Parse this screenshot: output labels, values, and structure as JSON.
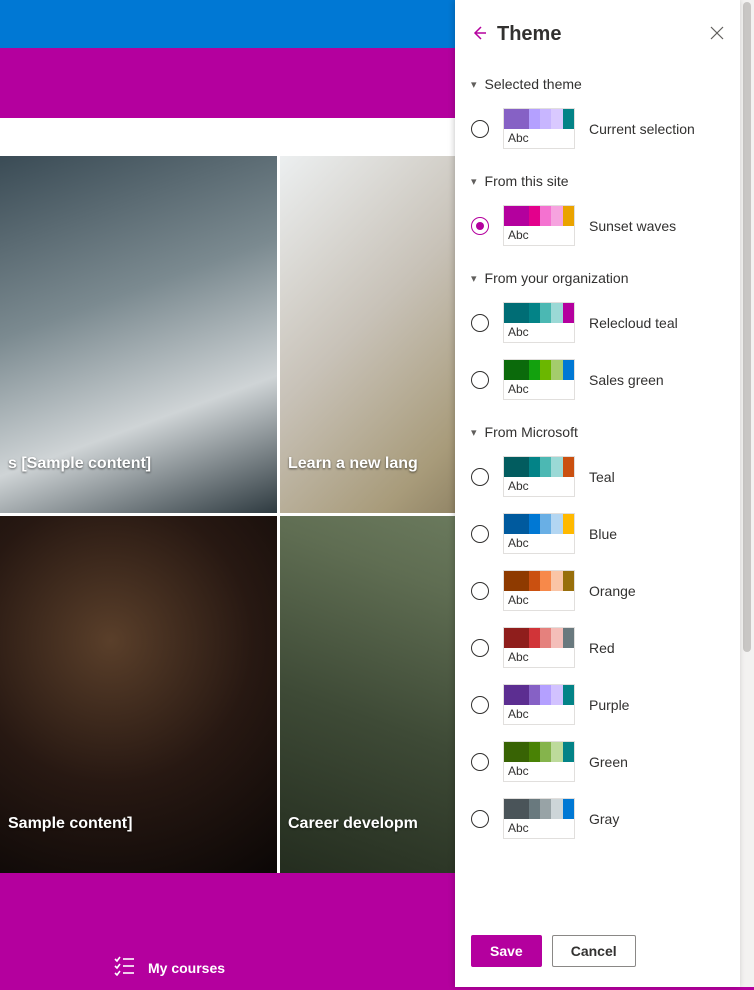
{
  "background": {
    "tiles": [
      {
        "caption": "s [Sample content]"
      },
      {
        "caption": "Learn a new lang"
      },
      {
        "caption": "Sample content]"
      },
      {
        "caption": "Career developm"
      }
    ],
    "bottombar_label": "My courses"
  },
  "panel": {
    "title": "Theme",
    "swatch_text": "Abc",
    "save_label": "Save",
    "cancel_label": "Cancel",
    "sections": [
      {
        "title": "Selected theme",
        "options": [
          {
            "name": "Current selection",
            "selected": false,
            "colors": [
              "#8661c5",
              "#b4a0ff",
              "#c8b6ff",
              "#d9c9ff",
              "#038387"
            ]
          }
        ]
      },
      {
        "title": "From this site",
        "options": [
          {
            "name": "Sunset waves",
            "selected": true,
            "colors": [
              "#b4009e",
              "#e3008c",
              "#f472d0",
              "#f6a3df",
              "#eaa300"
            ]
          }
        ]
      },
      {
        "title": "From your organization",
        "options": [
          {
            "name": "Relecloud teal",
            "selected": false,
            "colors": [
              "#006d75",
              "#038387",
              "#4bb8b3",
              "#9bd9d6",
              "#b4009e"
            ]
          },
          {
            "name": "Sales green",
            "selected": false,
            "colors": [
              "#0b6a0b",
              "#13a10e",
              "#6bb700",
              "#a4cc6c",
              "#0078d4"
            ]
          }
        ]
      },
      {
        "title": "From Microsoft",
        "options": [
          {
            "name": "Teal",
            "selected": false,
            "colors": [
              "#025c5f",
              "#038387",
              "#4cb8b3",
              "#9bd9d6",
              "#ca5010"
            ]
          },
          {
            "name": "Blue",
            "selected": false,
            "colors": [
              "#005a9e",
              "#0078d4",
              "#69afe5",
              "#b3d6f2",
              "#ffb900"
            ]
          },
          {
            "name": "Orange",
            "selected": false,
            "colors": [
              "#8e3a00",
              "#ca5010",
              "#f7894a",
              "#fac5a6",
              "#986f0b"
            ]
          },
          {
            "name": "Red",
            "selected": false,
            "colors": [
              "#8f1e1c",
              "#d13438",
              "#e5817d",
              "#f4beb9",
              "#69797e"
            ]
          },
          {
            "name": "Purple",
            "selected": false,
            "colors": [
              "#5c2e91",
              "#8661c5",
              "#b4a0ff",
              "#d2c2ff",
              "#038387"
            ]
          },
          {
            "name": "Green",
            "selected": false,
            "colors": [
              "#386304",
              "#498205",
              "#85b44c",
              "#bdda9b",
              "#038387"
            ]
          },
          {
            "name": "Gray",
            "selected": false,
            "colors": [
              "#4a5459",
              "#69797e",
              "#98a3a6",
              "#cdd5d8",
              "#0078d4"
            ]
          }
        ]
      }
    ]
  }
}
